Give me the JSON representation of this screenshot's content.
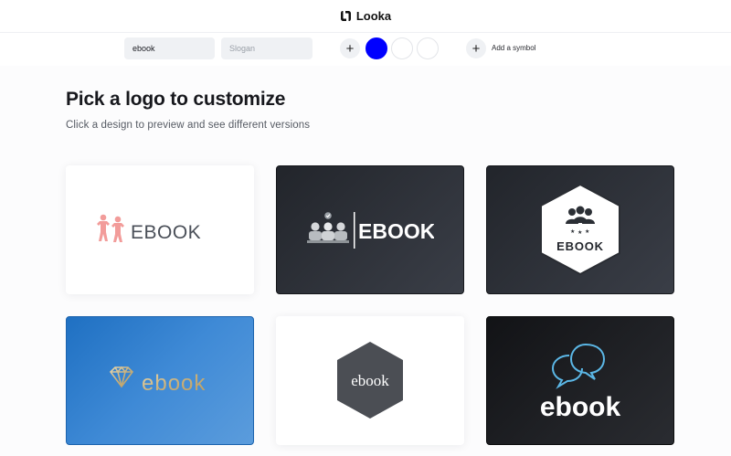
{
  "header": {
    "brand": "Looka"
  },
  "toolbar": {
    "company_name_value": "ebook",
    "slogan_placeholder": "Slogan",
    "add_color_label": "+",
    "colors": [
      "#0000ff",
      "#ffffff",
      "#ffffff"
    ],
    "add_symbol_icon": "+",
    "add_symbol_label": "Add a symbol"
  },
  "main": {
    "title": "Pick a logo to customize",
    "subtitle": "Click a design to preview and see different versions"
  },
  "logos": [
    {
      "text": "EBOOK",
      "style": "people-icon pink on white"
    },
    {
      "text": "EBOOK",
      "style": "team-check icon, white on dark"
    },
    {
      "text": "EBOOK",
      "style": "hexagon badge with group icon and stars, on dark"
    },
    {
      "text": "ebook",
      "style": "diamond icon, gold on blue"
    },
    {
      "text": "ebook",
      "style": "text in dark hexagon, on white"
    },
    {
      "text": "ebook",
      "style": "chat bubbles icon, on black"
    }
  ]
}
